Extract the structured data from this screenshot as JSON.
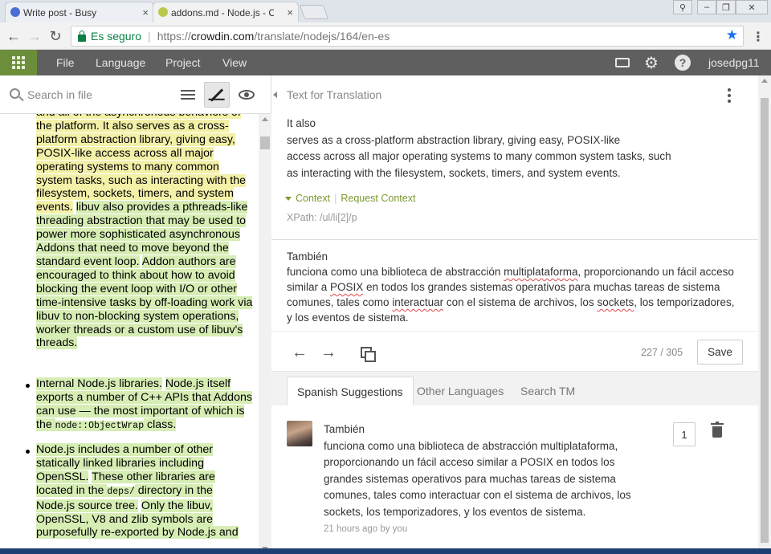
{
  "browser": {
    "tabs": [
      {
        "title": "Write post - Busy",
        "close": "×"
      },
      {
        "title": "addons.md - Node.js - Cr",
        "close": "×"
      }
    ],
    "window_controls": [
      "⚲",
      "–",
      "❐",
      "✕"
    ],
    "nav": {
      "back": "←",
      "forward": "→",
      "reload": "↻"
    },
    "address": {
      "secure_label": "Es seguro",
      "scheme": "https://",
      "host": "crowdin.com",
      "path": "/translate/nodejs/164/en-es"
    },
    "star": "★",
    "menu": "⋮"
  },
  "app_nav": {
    "items": [
      "File",
      "Language",
      "Project",
      "View"
    ],
    "user": "josedpg11",
    "help": "?",
    "gear": "⚙"
  },
  "left": {
    "search_placeholder": "Search in file",
    "doc": {
      "p1": [
        {
          "t": "and all of the asynchronous behaviors of the platform. ",
          "c": "hy"
        },
        {
          "t": "It also serves as a cross-platform abstraction library, giving easy, POSIX-like access across all major operating systems to many common system tasks, such as interacting with the filesystem, sockets, timers, and system events.",
          "c": "hy"
        },
        {
          "t": " ",
          "c": ""
        },
        {
          "t": "libuv also provides a pthreads-like threading abstraction that may be used to power more sophisticated asynchronous Addons that need to move beyond the standard event loop.",
          "c": "h"
        },
        {
          "t": " ",
          "c": ""
        },
        {
          "t": "Addon authors are encouraged to think about how to avoid blocking the event loop with I/O or other time-intensive tasks by off-loading work via libuv to non-blocking system operations, worker threads or a custom use of libuv's threads.",
          "c": "h"
        }
      ],
      "p2": [
        {
          "t": "Internal Node.js libraries.",
          "c": "h"
        },
        {
          "t": " ",
          "c": ""
        },
        {
          "t": "Node.js itself exports a number of C++ APIs that Addons can use — the most important of which is the ",
          "c": "h"
        },
        {
          "t": "node::ObjectWrap",
          "c": "code"
        },
        {
          "t": " class.",
          "c": "h"
        }
      ],
      "p3": [
        {
          "t": "Node.js includes a number of other statically linked libraries including OpenSSL.",
          "c": "h"
        },
        {
          "t": " ",
          "c": ""
        },
        {
          "t": "These other libraries are located in the ",
          "c": "h"
        },
        {
          "t": "deps/",
          "c": "code"
        },
        {
          "t": " directory in the Node.js source tree.",
          "c": "h"
        },
        {
          "t": " ",
          "c": ""
        },
        {
          "t": "Only the libuv, OpenSSL, V8 and zlib symbols are purposefully re-exported by Node.js and",
          "c": "h"
        }
      ]
    }
  },
  "right": {
    "title": "Text for Translation",
    "source_lines": [
      "It also",
      "serves as a cross-platform abstraction library, giving easy, POSIX-like",
      "access across all major operating systems to many common system tasks, such",
      "as interacting with the filesystem, sockets, timers, and system events."
    ],
    "context_label": "Context",
    "request_context": "Request Context",
    "xpath": "XPath: /ul/li[2]/p",
    "translation_segments": [
      {
        "t": "También",
        "br": true
      },
      {
        "t": "funciona como una biblioteca de abstracción "
      },
      {
        "t": "multiplataforma",
        "sp": true
      },
      {
        "t": ", proporcionando un fácil acceso similar a "
      },
      {
        "t": "POSIX",
        "sp": true
      },
      {
        "t": " en todos los grandes sistemas operativos para muchas tareas de sistema comunes, tales como "
      },
      {
        "t": "interactuar",
        "sp": true
      },
      {
        "t": " con el sistema de archivos, los "
      },
      {
        "t": "sockets",
        "sp": true
      },
      {
        "t": ", los temporizadores, y los eventos de sistema."
      }
    ],
    "counter": "227 / 305",
    "save_label": "Save",
    "tabs": [
      "Spanish Suggestions",
      "Other Languages",
      "Search TM"
    ],
    "suggestion": {
      "lines": [
        "También",
        "funciona como una biblioteca de abstracción multiplataforma,",
        "proporcionando un fácil acceso similar a POSIX en todos los",
        "grandes sistemas operativos para muchas tareas de sistema",
        "comunes, tales como interactuar con el sistema de archivos, los",
        "sockets, los temporizadores, y los eventos de sistema."
      ],
      "meta": "21 hours ago by you",
      "votes": "1"
    }
  },
  "colors": {
    "accent_green": "#6c8e3a",
    "nav_bg": "#5f5f5f",
    "highlight_green": "#d6edb4",
    "highlight_yellow": "#f3f0a8",
    "context_green": "#7a9a2e",
    "secure_green": "#0b8043"
  }
}
